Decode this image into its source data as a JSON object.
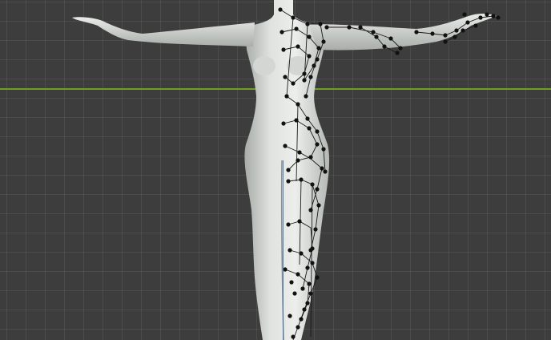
{
  "viewport": {
    "colors": {
      "background": "#3d3d3d",
      "grid_line": "#4a4a4a",
      "x_axis": "#6f9e22",
      "z_axis": "#3f6fb8",
      "mesh_light": "#e6e8e6",
      "mesh_shadow": "#9aa09c",
      "vertex": "#111111",
      "edge": "#1a1a1a"
    },
    "object": "humanoid-mesh",
    "mode": "edit-mode-vertex-selection"
  }
}
